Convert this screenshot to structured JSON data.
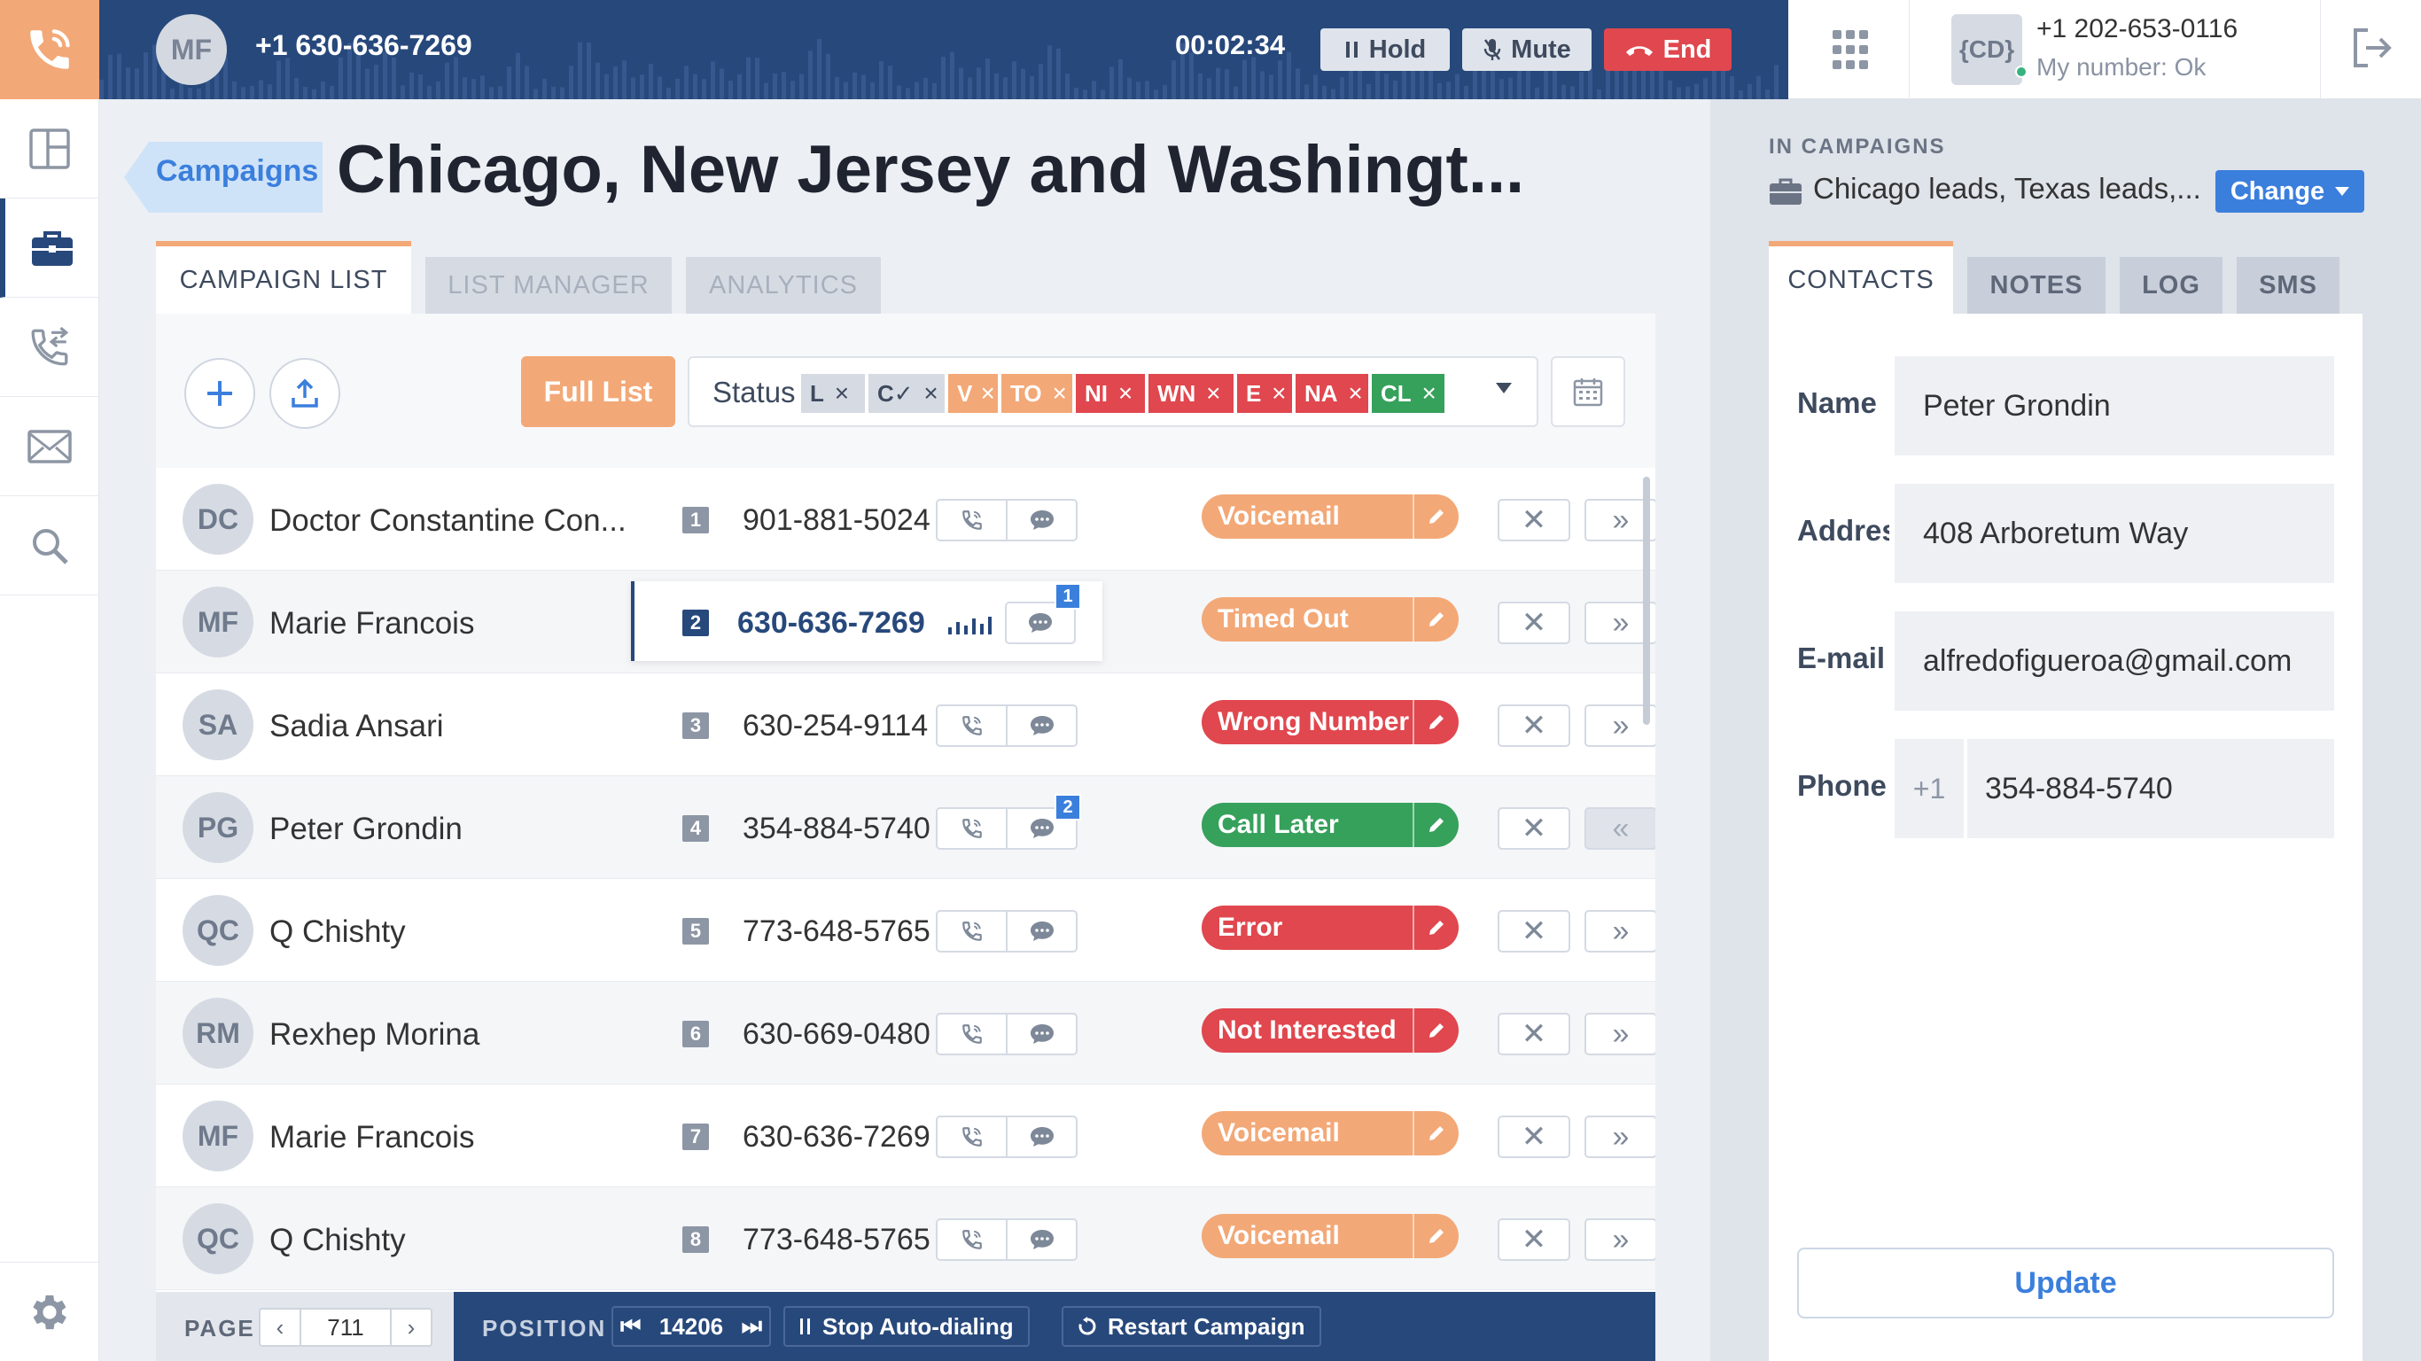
{
  "call": {
    "avatar_initials": "MF",
    "number": "+1 630-636-7269",
    "timer": "00:02:34",
    "hold_label": "Hold",
    "mute_label": "Mute",
    "end_label": "End"
  },
  "account": {
    "badge": "{CD}",
    "phone": "+1 202-653-0116",
    "status": "My number: Ok"
  },
  "nav": {
    "items": [
      "dashboard-icon",
      "briefcase-icon",
      "call-transfer-icon",
      "mail-icon",
      "search-icon"
    ],
    "settings": "gear-icon"
  },
  "page": {
    "breadcrumb": "Campaigns",
    "title": "Chicago, New Jersey and Washingt..."
  },
  "tabs": [
    "CAMPAIGN LIST",
    "LIST MANAGER",
    "ANALYTICS"
  ],
  "toolbar": {
    "full_list": "Full List",
    "status_label": "Status",
    "chips": [
      {
        "label": "L",
        "color": "#d6dbe3",
        "text": "#3e4a5e"
      },
      {
        "label": "C✓",
        "color": "#d6dbe3",
        "text": "#3e4a5e"
      },
      {
        "label": "V",
        "color": "#f3a877",
        "text": "#ffffff"
      },
      {
        "label": "TO",
        "color": "#f3a877",
        "text": "#ffffff"
      },
      {
        "label": "NI",
        "color": "#e0474e",
        "text": "#ffffff"
      },
      {
        "label": "WN",
        "color": "#e0474e",
        "text": "#ffffff"
      },
      {
        "label": "E",
        "color": "#e0474e",
        "text": "#ffffff"
      },
      {
        "label": "NA",
        "color": "#e0474e",
        "text": "#ffffff"
      },
      {
        "label": "CL",
        "color": "#36a15b",
        "text": "#ffffff"
      }
    ]
  },
  "contacts": [
    {
      "initials": "DC",
      "name": "Doctor Constantine Con...",
      "num": "1",
      "phone": "901-881-5024",
      "status": "Voicemail",
      "status_color": "#f3a877"
    },
    {
      "initials": "MF",
      "name": "Marie Francois",
      "num": "2",
      "phone": "630-636-7269",
      "status": "Timed Out",
      "status_color": "#f3a877",
      "sms_count": "1"
    },
    {
      "initials": "SA",
      "name": "Sadia Ansari",
      "num": "3",
      "phone": "630-254-9114",
      "status": "Wrong Number",
      "status_color": "#e0474e"
    },
    {
      "initials": "PG",
      "name": "Peter Grondin",
      "num": "4",
      "phone": "354-884-5740",
      "status": "Call Later",
      "status_color": "#36a15b",
      "sms_count": "2"
    },
    {
      "initials": "QC",
      "name": "Q Chishty",
      "num": "5",
      "phone": "773-648-5765",
      "status": "Error",
      "status_color": "#e0474e"
    },
    {
      "initials": "RM",
      "name": "Rexhep Morina",
      "num": "6",
      "phone": "630-669-0480",
      "status": "Not Interested",
      "status_color": "#e0474e"
    },
    {
      "initials": "MF",
      "name": "Marie Francois",
      "num": "7",
      "phone": "630-636-7269",
      "status": "Voicemail",
      "status_color": "#f3a877"
    },
    {
      "initials": "QC",
      "name": "Q Chishty",
      "num": "8",
      "phone": "773-648-5765",
      "status": "Voicemail",
      "status_color": "#f3a877"
    }
  ],
  "footer": {
    "page_label": "PAGE",
    "page_value": "711",
    "position_label": "POSITION",
    "position_value": "14206",
    "stop_label": "Stop Auto-dialing",
    "restart_label": "Restart Campaign"
  },
  "right": {
    "in_campaigns_label": "IN CAMPAIGNS",
    "in_campaigns_value": "Chicago leads, Texas leads,...",
    "change_label": "Change",
    "tabs": [
      "CONTACTS",
      "NOTES",
      "LOG",
      "SMS"
    ],
    "fields": {
      "name_label": "Name",
      "name_value": "Peter Grondin",
      "address_label": "Address",
      "address_value": "408 Arboretum Way",
      "email_label": "E-mail",
      "email_value": "alfredofigueroa@gmail.com",
      "phone_label": "Phone",
      "phone_prefix": "+1",
      "phone_value": "354-884-5740"
    },
    "update_label": "Update"
  }
}
